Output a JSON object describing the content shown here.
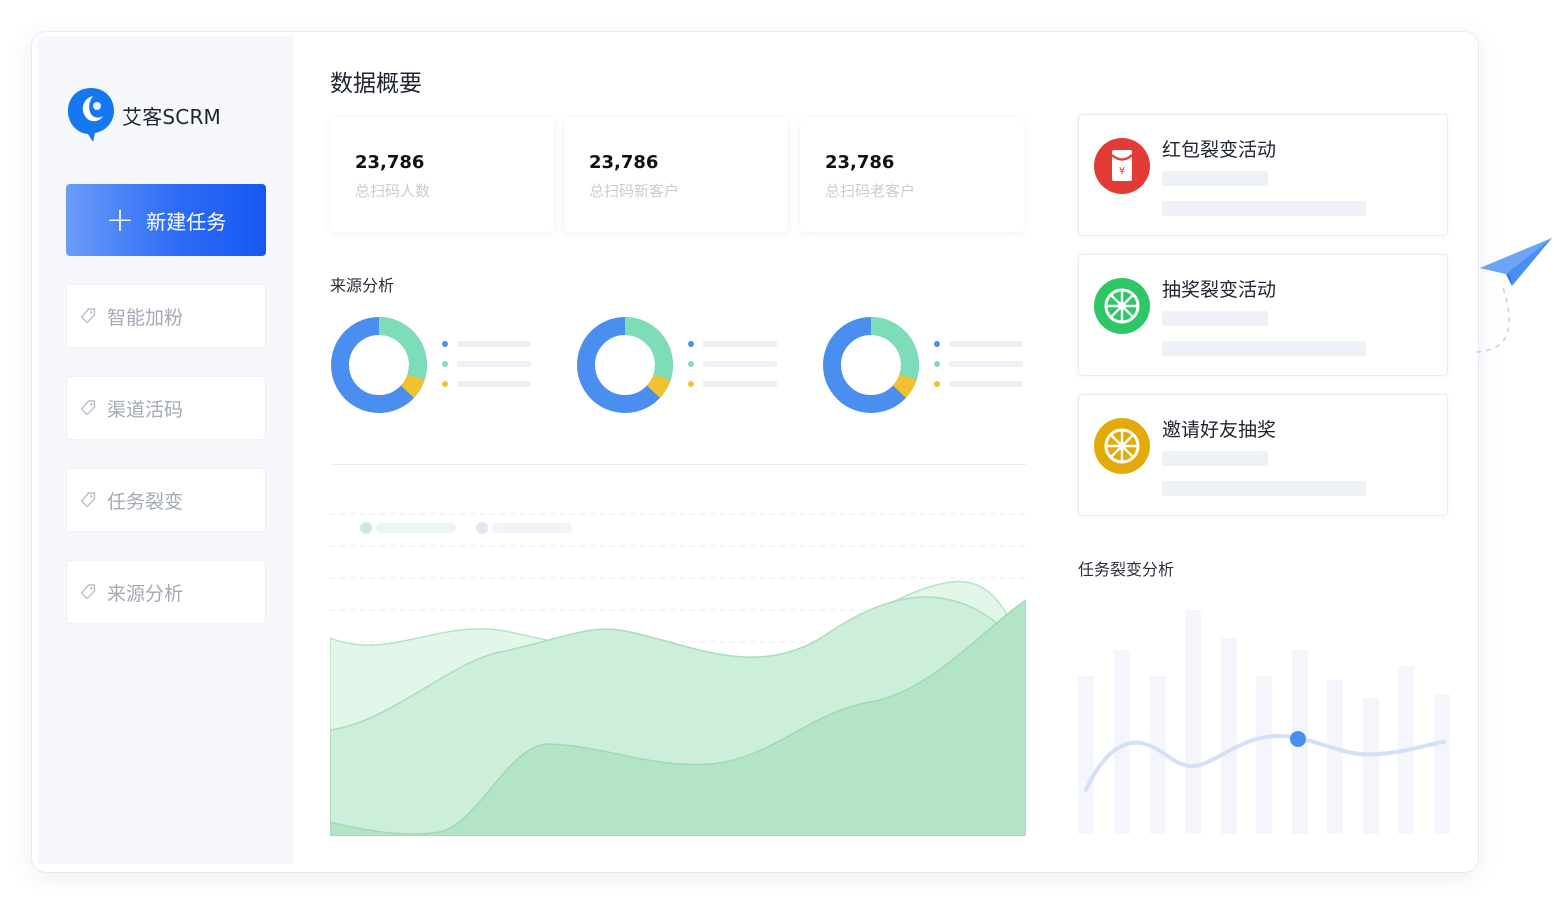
{
  "app": {
    "name": "艾客SCRM"
  },
  "sidebar": {
    "new_task_label": "新建任务",
    "items": [
      {
        "label": "智能加粉"
      },
      {
        "label": "渠道活码"
      },
      {
        "label": "任务裂变"
      },
      {
        "label": "来源分析"
      }
    ]
  },
  "main": {
    "title": "数据概要",
    "stats": [
      {
        "value": "23,786",
        "label": "总扫码人数"
      },
      {
        "value": "23,786",
        "label": "总扫码新客户"
      },
      {
        "value": "23,786",
        "label": "总扫码老客户"
      }
    ],
    "source_section_title": "来源分析"
  },
  "right": {
    "activities": [
      {
        "title": "红包裂变活动",
        "icon": "red-envelope-icon",
        "color": "#e23b35"
      },
      {
        "title": "抽奖裂变活动",
        "icon": "prize-wheel-icon",
        "color": "#2fc666"
      },
      {
        "title": "邀请好友抽奖",
        "icon": "prize-wheel-icon",
        "color": "#e3aa0a"
      }
    ],
    "fission_section_title": "任务裂变分析"
  },
  "colors": {
    "primary": "#1758f2",
    "donut_blue": "#4a8ef0",
    "donut_green": "#7dddb8",
    "donut_yellow": "#f0c130",
    "area_green": "#a6e0c0"
  }
}
